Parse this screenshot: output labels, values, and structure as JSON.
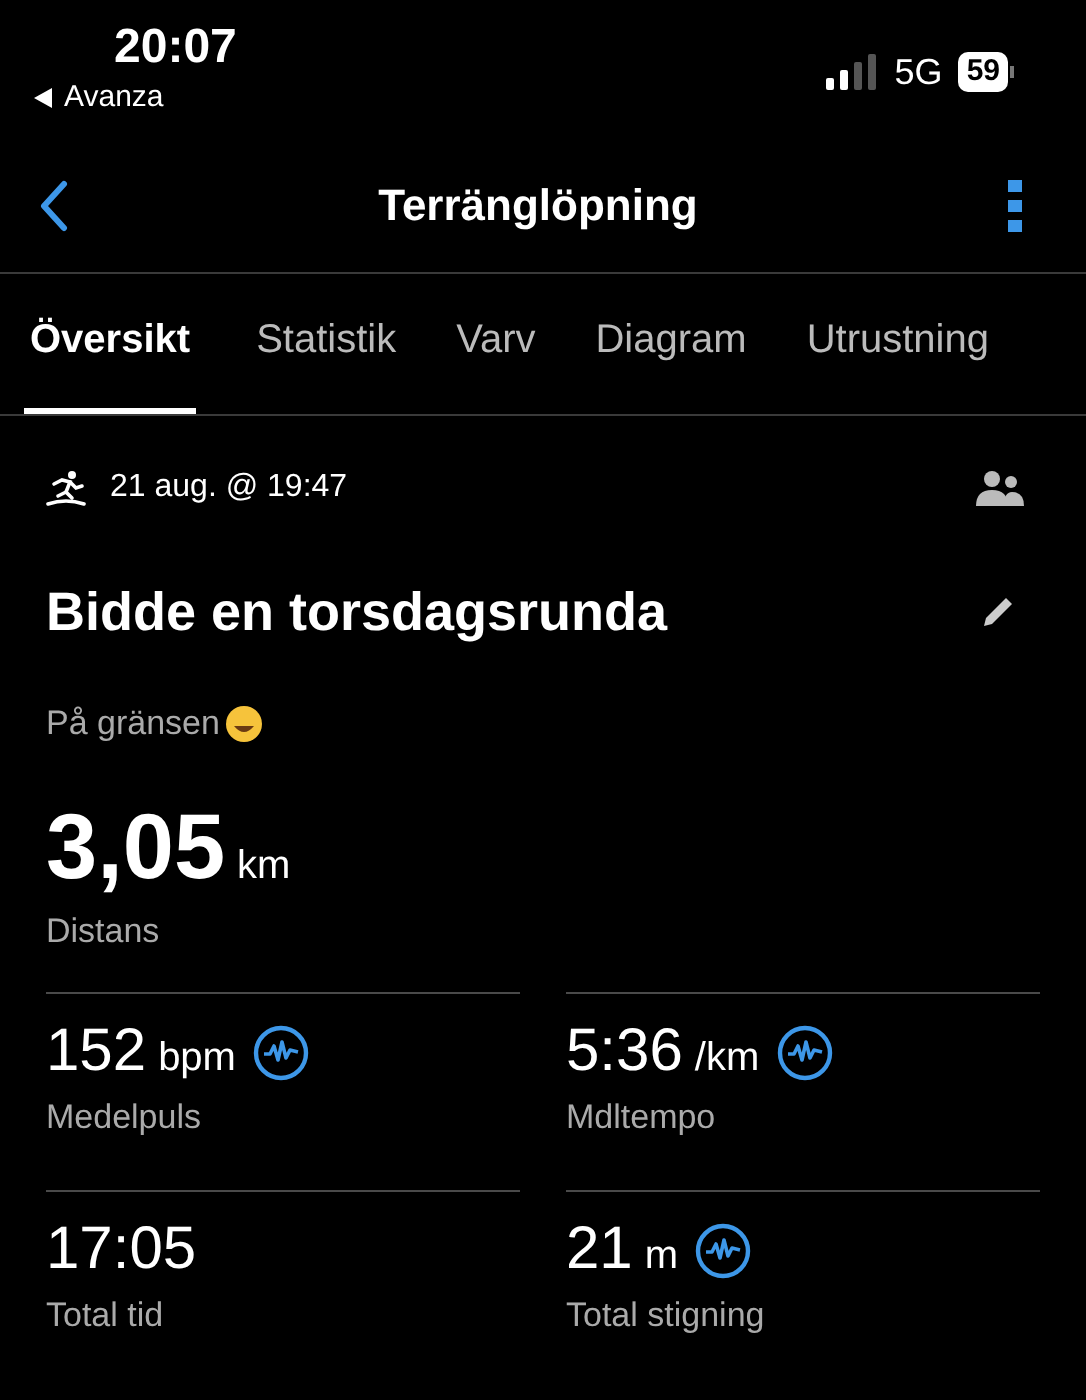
{
  "status_bar": {
    "time": "20:07",
    "back_app": "Avanza",
    "network": "5G",
    "battery": "59"
  },
  "nav": {
    "title": "Terränglöpning"
  },
  "tabs": [
    {
      "label": "Översikt",
      "selected": true
    },
    {
      "label": "Statistik",
      "selected": false
    },
    {
      "label": "Varv",
      "selected": false
    },
    {
      "label": "Diagram",
      "selected": false
    },
    {
      "label": "Utrustning",
      "selected": false
    }
  ],
  "activity": {
    "date": "21 aug. @ 19:47",
    "title": "Bidde en torsdagsrunda",
    "note": "På gränsen"
  },
  "distance": {
    "value": "3,05",
    "unit": "km",
    "label": "Distans"
  },
  "stats": [
    {
      "value": "152",
      "unit": "bpm",
      "label": "Medelpuls",
      "chart": true
    },
    {
      "value": "5:36",
      "unit": "/km",
      "label": "Mdltempo",
      "chart": true
    },
    {
      "value": "17:05",
      "label": "Total tid",
      "chart": false
    },
    {
      "value": "21",
      "unit": "m",
      "label": "Total stigning",
      "chart": true
    }
  ]
}
